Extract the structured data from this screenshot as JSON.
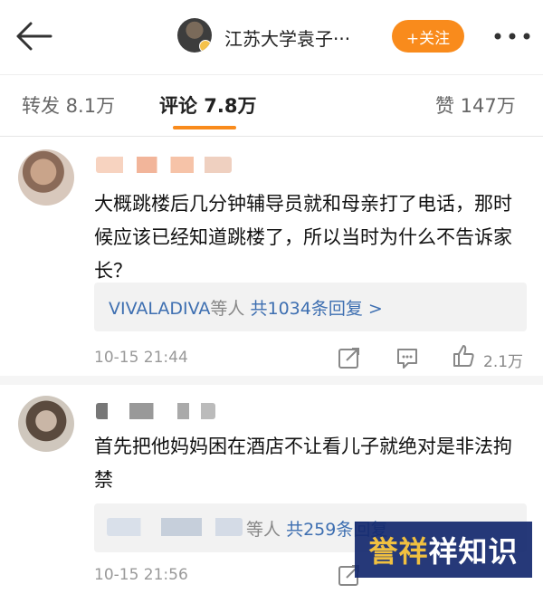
{
  "header": {
    "title": "江苏大学袁子···",
    "follow_label": "+关注"
  },
  "tabs": [
    {
      "label": "转发 8.1万"
    },
    {
      "label": "评论 7.8万"
    },
    {
      "label": "赞 147万"
    }
  ],
  "comments": [
    {
      "text": "大概跳楼后几分钟辅导员就和母亲打了电话，那时候应该已经知道跳楼了，所以当时为什么不告诉家长？",
      "reply_prefix": "VIVALADIVA",
      "reply_mid": "等人",
      "reply_count": "共1034条回复 >",
      "time": "10-15 21:44",
      "likes": "2.1万"
    },
    {
      "text": "首先把他妈妈困在酒店不让看儿子就绝对是非法拘禁",
      "reply_mid": "等人",
      "reply_count": "共259条回复",
      "time": "10-15 21:56",
      "likes": ""
    }
  ],
  "watermark": {
    "part1": "誉",
    "part2": "祥",
    "part3": "祥知识"
  },
  "colors": {
    "accent": "#f98b1c",
    "link": "#3e6fb1"
  }
}
